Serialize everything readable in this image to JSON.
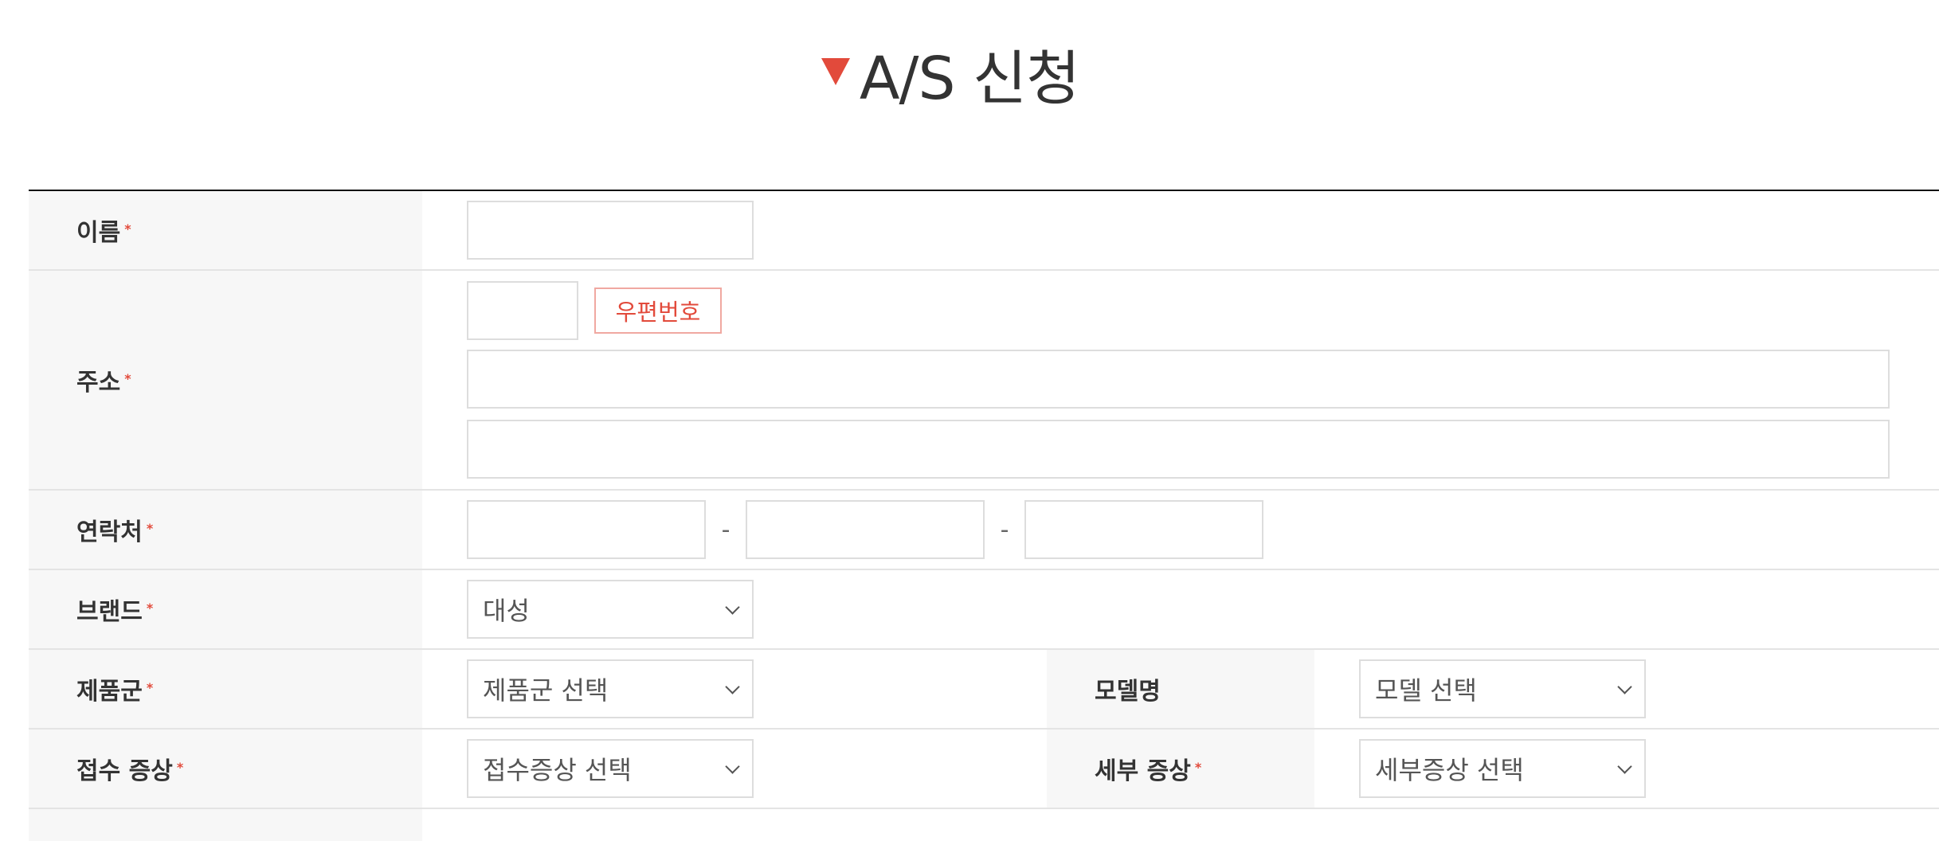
{
  "page_title": "A/S 신청",
  "required_mark": "*",
  "fields": {
    "name": {
      "label": "이름",
      "value": ""
    },
    "address": {
      "label": "주소",
      "zip_button": "우편번호"
    },
    "contact": {
      "label": "연락처",
      "separator": "-"
    },
    "brand": {
      "label": "브랜드",
      "selected": "대성"
    },
    "product_group": {
      "label": "제품군",
      "selected": "제품군 선택"
    },
    "model": {
      "label": "모델명",
      "selected": "모델 선택"
    },
    "symptom": {
      "label": "접수 증상",
      "selected": "접수증상 선택"
    },
    "detail_symptom": {
      "label": "세부 증상",
      "selected": "세부증상 선택"
    }
  },
  "colors": {
    "accent": "#e24a3b",
    "label_bg": "#f7f7f7",
    "border": "#dddddd"
  },
  "icons": [
    "title-triangle-icon",
    "chevron-down-icon"
  ]
}
